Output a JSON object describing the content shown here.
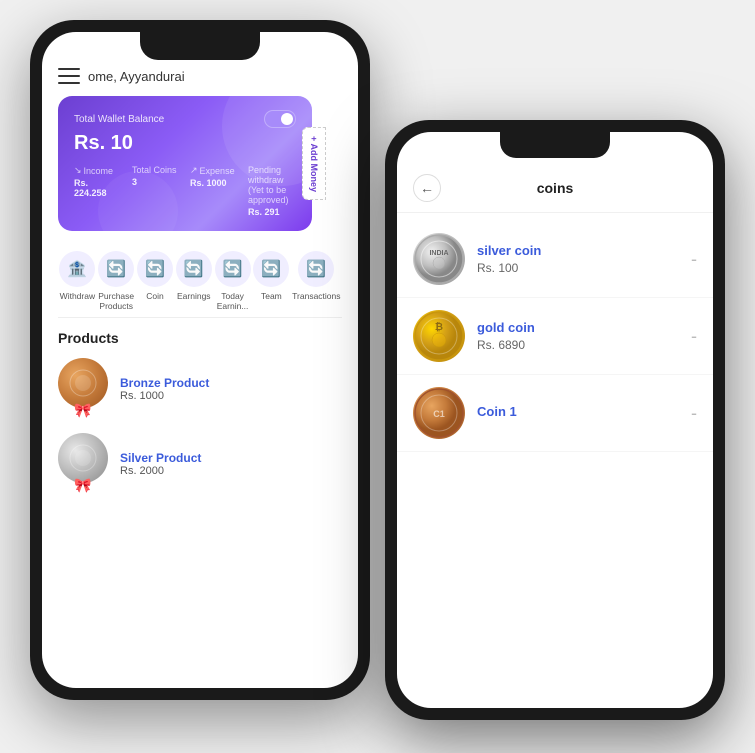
{
  "phone1": {
    "welcome_text": "ome, Ayyandurai",
    "wallet": {
      "label": "Total Wallet Balance",
      "balance": "Rs. 10",
      "income_label": "Income",
      "income_value": "Rs. 224.258",
      "coins_label": "Total Coins",
      "coins_value": "3",
      "expense_label": "Expense",
      "expense_value": "Rs. 1000",
      "pending_label": "Pending withdraw (Yet to be approved)",
      "pending_value": "Rs. 291",
      "add_money": "+ Add Money"
    },
    "nav": [
      {
        "icon": "🏦",
        "label": "Withdraw"
      },
      {
        "icon": "🔄",
        "label": "Purchase\nProducts"
      },
      {
        "icon": "🔄",
        "label": "Coin"
      },
      {
        "icon": "🔄",
        "label": "Earnings"
      },
      {
        "icon": "🔄",
        "label": "Today\nEarnin..."
      },
      {
        "icon": "🔄",
        "label": "Team"
      },
      {
        "icon": "🔄",
        "label": "Transactions"
      }
    ],
    "products_title": "Products",
    "products": [
      {
        "name": "Bronze Product",
        "price": "Rs. 1000",
        "type": "bronze"
      },
      {
        "name": "Silver Product",
        "price": "Rs. 2000",
        "type": "silver"
      }
    ]
  },
  "phone2": {
    "title": "coins",
    "back_label": "←",
    "coins": [
      {
        "name": "silver coin",
        "price": "Rs. 100",
        "type": "silver"
      },
      {
        "name": "gold coin",
        "price": "Rs. 6890",
        "type": "gold"
      },
      {
        "name": "Coin 1",
        "price": "",
        "type": "bronze"
      }
    ]
  }
}
